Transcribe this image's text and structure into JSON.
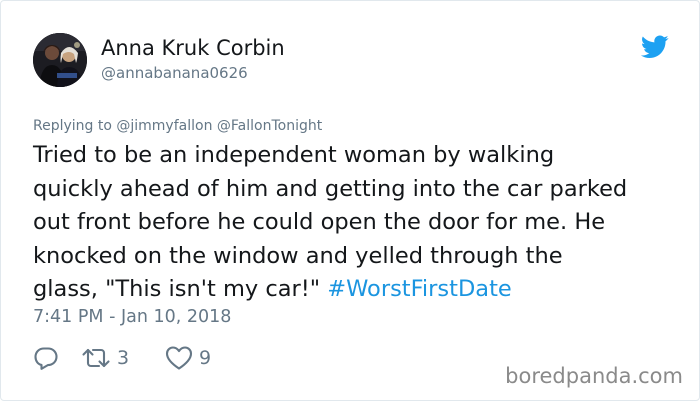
{
  "tweet": {
    "author_name": "Anna Kruk Corbin",
    "author_handle": "@annabanana0626",
    "replying_to": "Replying to @jimmyfallon @FallonTonight",
    "text_lines": [
      "Tried to be an independent woman by walking",
      "quickly ahead of him and getting into the car parked",
      "out front before he could open the door for me. He",
      "knocked on the window and yelled through the",
      "glass, \"This isn't my car!\""
    ],
    "hashtag": "#WorstFirstDate",
    "timestamp": "7:41 PM - Jan 10, 2018",
    "retweet_count": "3",
    "like_count": "9"
  },
  "icons": {
    "brand": "twitter-bird-icon",
    "reply": "reply-icon",
    "retweet": "retweet-icon",
    "like": "heart-icon"
  },
  "colors": {
    "brand_blue": "#1da1f2",
    "hashtag": "#1b95e0",
    "secondary_text": "#657786"
  },
  "watermark": "boredpanda.com"
}
